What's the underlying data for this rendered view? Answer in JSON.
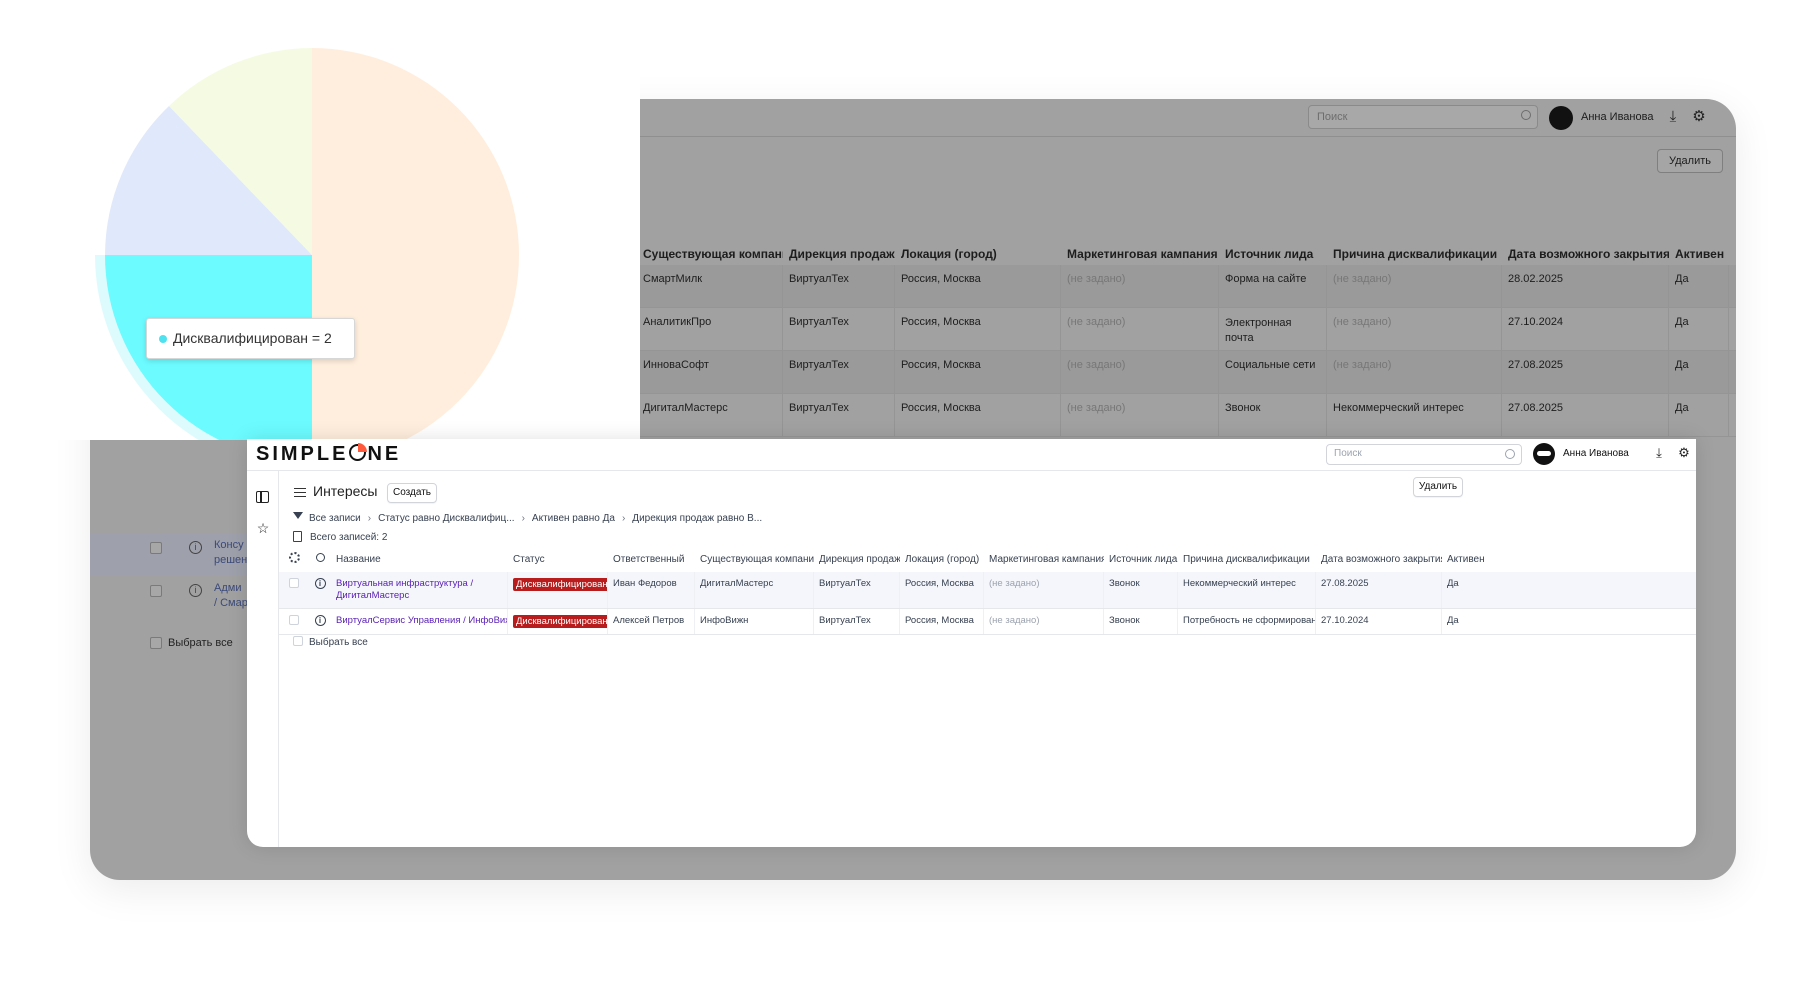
{
  "background_window": {
    "search_placeholder": "Поиск",
    "user_name": "Анна Иванова",
    "delete_label": "Удалить",
    "columns": [
      "Существующая компания",
      "Дирекция продаж",
      "Локация (город)",
      "Маркетинговая кампания",
      "Источник лида",
      "Причина дисквалификации",
      "Дата возможного закрытия",
      "Активен"
    ],
    "rows": [
      [
        "СмартМилк",
        "ВиртуалТех",
        "Россия, Москва",
        "(не задано)",
        "Форма на сайте",
        "(не задано)",
        "28.02.2025",
        "Да"
      ],
      [
        "АналитикПро",
        "ВиртуалТех",
        "Россия, Москва",
        "(не задано)",
        "Электронная почта",
        "(не задано)",
        "27.10.2024",
        "Да"
      ],
      [
        "ИнноваСофт",
        "ВиртуалТех",
        "Россия, Москва",
        "(не задано)",
        "Социальные сети",
        "(не задано)",
        "27.08.2025",
        "Да"
      ],
      [
        "ДигиталМастерс",
        "ВиртуалТех",
        "Россия, Москва",
        "(не задано)",
        "Звонок",
        "Некоммерческий интерес",
        "27.08.2025",
        "Да"
      ]
    ],
    "left_rows": [
      {
        "line1": "Консу",
        "line2": "решен"
      },
      {
        "line1": "Адми",
        "line2": "/ Смар"
      }
    ],
    "select_all": "Выбрать все"
  },
  "pie": {
    "tooltip": "Дисквалифицирован = 2",
    "tooltip_color": "#4ee2f0",
    "slices_colors": [
      "#ffeedd",
      "#6cfbff",
      "#e0e8fb",
      "#f4fbe2"
    ]
  },
  "front_window": {
    "logo": {
      "part1": "SIMPLE",
      "part2": "NE"
    },
    "search_placeholder": "Поиск",
    "user_name": "Анна Иванова",
    "page_title": "Интересы",
    "create_label": "Создать",
    "delete_label": "Удалить",
    "filter": {
      "all": "Все записи",
      "f1": "Статус равно Дисквалифиц...",
      "f2": "Активен равно Да",
      "f3": "Дирекция продаж равно В..."
    },
    "total": "Всего записей: 2",
    "columns": [
      "Название",
      "Статус",
      "Ответственный",
      "Существующая компания",
      "Дирекция продаж",
      "Локация (город)",
      "Маркетинговая кампания",
      "Источник лида",
      "Причина дисквалификации",
      "Дата возможного закрытия",
      "Активен"
    ],
    "rows": [
      {
        "name": "Виртуальная инфраструктура / ДигиталМастерс",
        "status": "Дисквалифицирован",
        "owner": "Иван Федоров",
        "company": "ДигиталМастерс",
        "direction": "ВиртуалТех",
        "location": "Россия, Москва",
        "campaign": "(не задано)",
        "source": "Звонок",
        "reason": "Некоммерческий интерес",
        "date": "27.08.2025",
        "active": "Да"
      },
      {
        "name": "ВиртуалСервис Управления / ИнфоВижн",
        "status": "Дисквалифицирован",
        "owner": "Алексей Петров",
        "company": "ИнфоВижн",
        "direction": "ВиртуалТех",
        "location": "Россия, Москва",
        "campaign": "(не задано)",
        "source": "Звонок",
        "reason": "Потребность не сформирована",
        "date": "27.10.2024",
        "active": "Да"
      }
    ],
    "select_all": "Выбрать все",
    "status_color": "#b91c1c",
    "link_color": "#5b21b6"
  }
}
